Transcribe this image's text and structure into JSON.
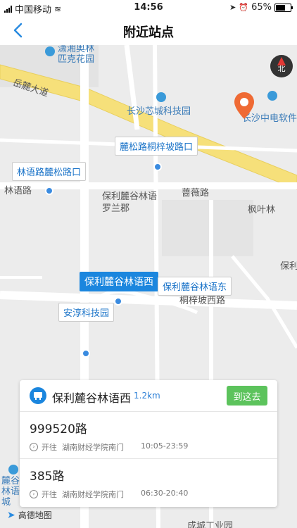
{
  "status": {
    "carrier": "中国移动",
    "time": "14:56",
    "battery": "65%"
  },
  "nav": {
    "title": "附近站点"
  },
  "map": {
    "road_labels": [
      "岳麓大道",
      "林语路",
      "桐梓坡西路",
      "保利麓谷林语罗兰郡",
      "蔷薇路",
      "枫叶林",
      "保利",
      "长沙芯城科技园",
      "长沙中电软件",
      "潇湘奥林匹克花园",
      "麓谷林语城",
      "成城工业园",
      "安淳科技园"
    ],
    "stop_callouts": [
      "麓松路桐梓坡路口",
      "林语路麓松路口",
      "保利麓谷林语西",
      "保利麓谷林语东",
      "安淳科技园"
    ],
    "compass_label": "北",
    "logo_text": "高德地图"
  },
  "card": {
    "stop_name": "保利麓谷林语西",
    "distance": "1.2km",
    "go_button": "到这去",
    "routes": [
      {
        "number": "999520路",
        "direction": "开往",
        "destination": "湖南财经学院南门",
        "hours": "10:05-23:59"
      },
      {
        "number": "385路",
        "direction": "开往",
        "destination": "湖南财经学院南门",
        "hours": "06:30-20:40"
      }
    ]
  }
}
